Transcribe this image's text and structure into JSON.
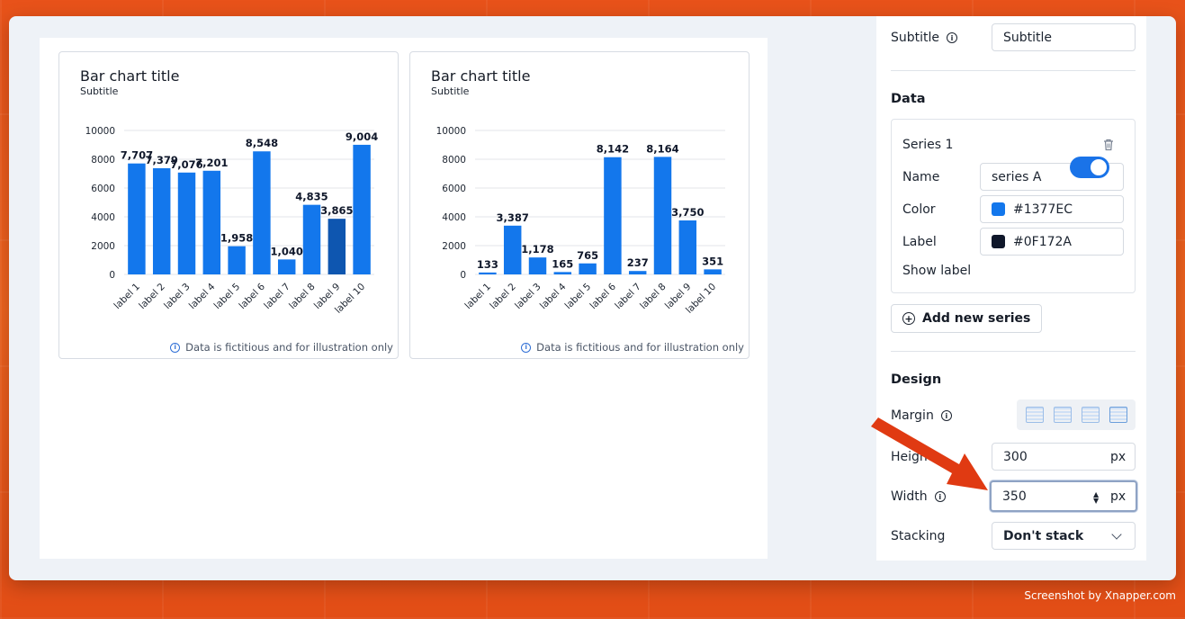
{
  "charts": [
    {
      "title": "Bar chart title",
      "subtitle": "Subtitle",
      "note": "Data is fictitious and for illustration only",
      "chart_data": {
        "type": "bar",
        "categories": [
          "label 1",
          "label 2",
          "label 3",
          "label 4",
          "label 5",
          "label 6",
          "label 7",
          "label 8",
          "label 9",
          "label 10"
        ],
        "values": [
          7707,
          7379,
          7076,
          7201,
          1958,
          8548,
          1040,
          4835,
          3865,
          9004
        ],
        "data_labels": [
          "7,707",
          "7,379",
          "7,076",
          "7,201",
          "1,958",
          "8,548",
          "1,040",
          "4,835",
          "3,865",
          "9,004"
        ],
        "ylim": [
          0,
          10000
        ],
        "yticks": [
          "0",
          "2000",
          "4000",
          "6000",
          "8000",
          "10000"
        ],
        "grid": true,
        "bar_color": "#1377EC",
        "highlight_index": 8,
        "highlight_color": "#0E56B0"
      }
    },
    {
      "title": "Bar chart title",
      "subtitle": "Subtitle",
      "note": "Data is fictitious and for illustration only",
      "chart_data": {
        "type": "bar",
        "categories": [
          "label 1",
          "label 2",
          "label 3",
          "label 4",
          "label 5",
          "label 6",
          "label 7",
          "label 8",
          "label 9",
          "label 10"
        ],
        "values": [
          133,
          3387,
          1178,
          165,
          765,
          8142,
          237,
          8164,
          3750,
          351
        ],
        "data_labels": [
          "133",
          "3,387",
          "1,178",
          "165",
          "765",
          "8,142",
          "237",
          "8,164",
          "3,750",
          "351"
        ],
        "ylim": [
          0,
          10000
        ],
        "yticks": [
          "0",
          "2000",
          "4000",
          "6000",
          "8000",
          "10000"
        ],
        "grid": true,
        "bar_color": "#1377EC"
      }
    }
  ],
  "panel": {
    "subtitle_label": "Subtitle",
    "subtitle_value": "Subtitle",
    "data_section": "Data",
    "series": {
      "title": "Series 1",
      "name_label": "Name",
      "name_value": "series A",
      "color_label": "Color",
      "color_value": "#1377EC",
      "label_label": "Label",
      "label_value": "#0F172A",
      "show_label": "Show label",
      "show_label_on": true
    },
    "add_series": "Add new series",
    "design_section": "Design",
    "margin_label": "Margin",
    "height_label": "Height",
    "height_value": "300",
    "width_label": "Width",
    "width_value": "350",
    "unit": "px",
    "stacking_label": "Stacking",
    "stacking_value": "Don't stack"
  },
  "watermark": "Screenshot by Xnapper.com",
  "colors": {
    "accent": "#1A73E8",
    "arrow": "#E03A12"
  }
}
